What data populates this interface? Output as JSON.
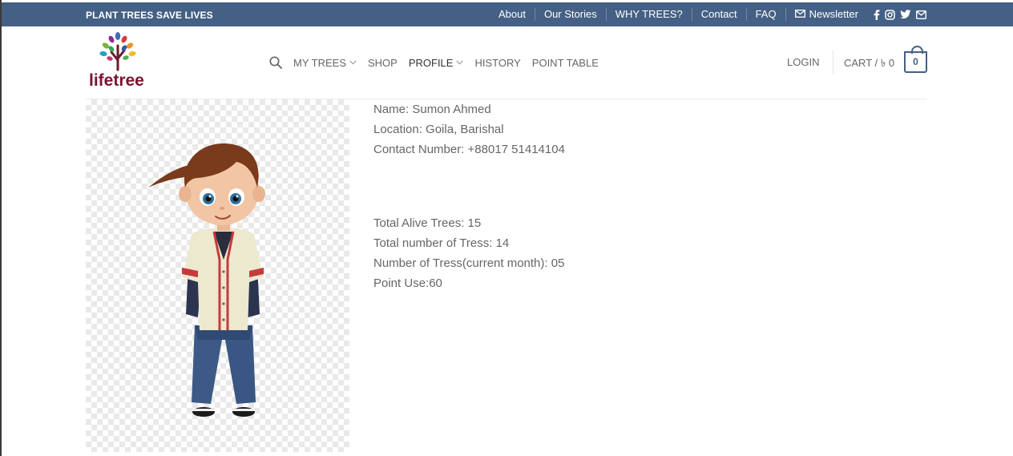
{
  "topbar": {
    "tagline": "PLANT TREES SAVE LIVES",
    "links": [
      "About",
      "Our Stories",
      "WHY TREES?",
      "Contact",
      "FAQ"
    ],
    "newsletter": "Newsletter",
    "social_icons": [
      "facebook-icon",
      "instagram-icon",
      "twitter-icon",
      "mail-icon"
    ],
    "bg_color": "#446084"
  },
  "logo": {
    "text": "lifetree"
  },
  "nav": {
    "items": [
      "MY TREES",
      "SHOP",
      "PROFILE",
      "HISTORY",
      "POINT TABLE"
    ],
    "active": "PROFILE"
  },
  "header_right": {
    "login": "LOGIN",
    "cart_label": "CART / ৳ 0",
    "cart_count": "0"
  },
  "profile": {
    "name": "Name: Sumon Ahmed",
    "location": "Location: Goila, Barishal",
    "contact": "Contact Number: +88017 51414104"
  },
  "stats": {
    "alive": "Total Alive Trees: 15",
    "total": "Total number of Tress: 14",
    "current_month": "Number of Tress(current month): 05",
    "point_use": "Point Use:60"
  }
}
